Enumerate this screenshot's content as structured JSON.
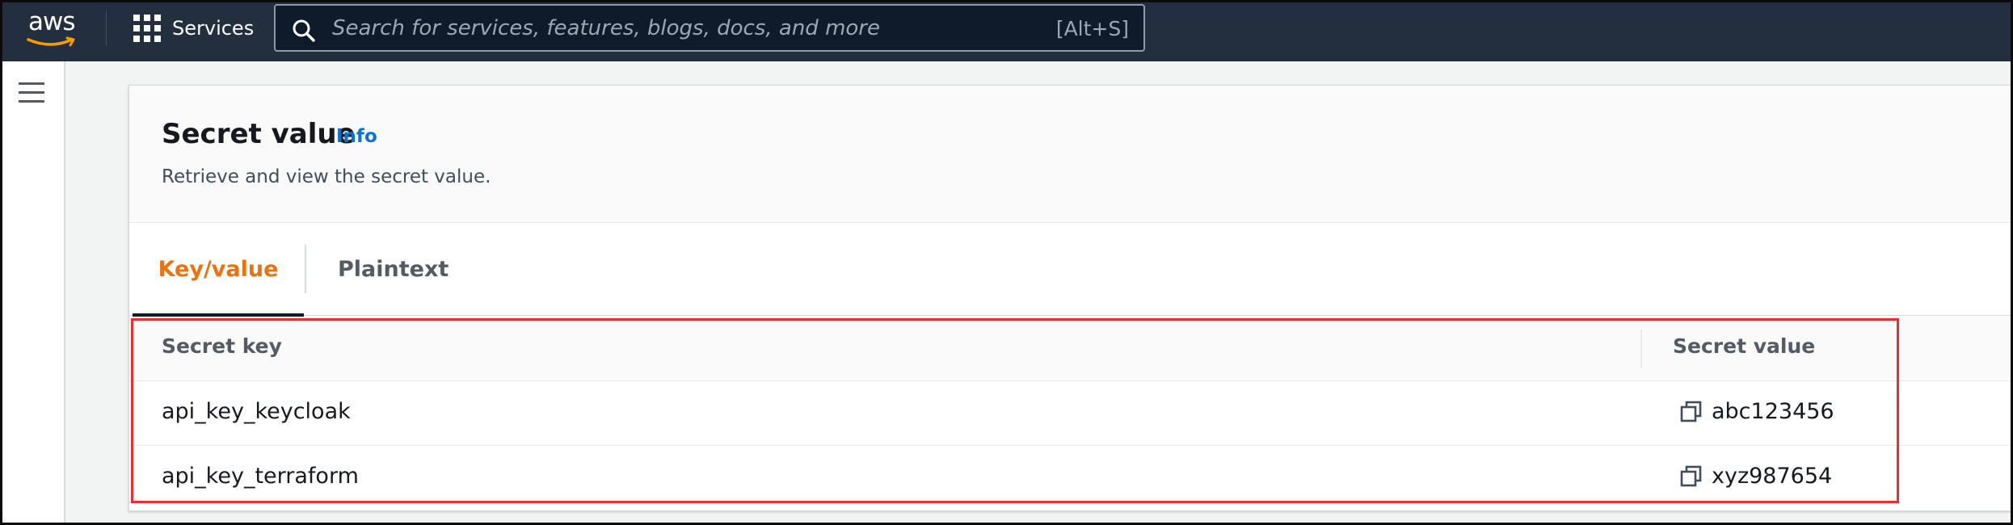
{
  "topnav": {
    "logo_text": "aws",
    "services_label": "Services",
    "search_placeholder": "Search for services, features, blogs, docs, and more",
    "search_shortcut": "[Alt+S]"
  },
  "panel": {
    "title": "Secret value",
    "info_link": "Info",
    "description": "Retrieve and view the secret value."
  },
  "tabs": [
    {
      "label": "Key/value",
      "active": true
    },
    {
      "label": "Plaintext",
      "active": false
    }
  ],
  "table": {
    "headers": [
      "Secret key",
      "Secret value"
    ],
    "rows": [
      {
        "key": "api_key_keycloak",
        "value": "abc123456"
      },
      {
        "key": "api_key_terraform",
        "value": "xyz987654"
      }
    ]
  },
  "colors": {
    "nav_background": "#232f3e",
    "active_tab": "#ec7211",
    "info_link": "#0972d3",
    "highlight_border": "#e0343a"
  },
  "icons": [
    "aws-logo-smile",
    "grid-icon",
    "search-icon",
    "hamburger-menu-icon",
    "copy-icon"
  ]
}
